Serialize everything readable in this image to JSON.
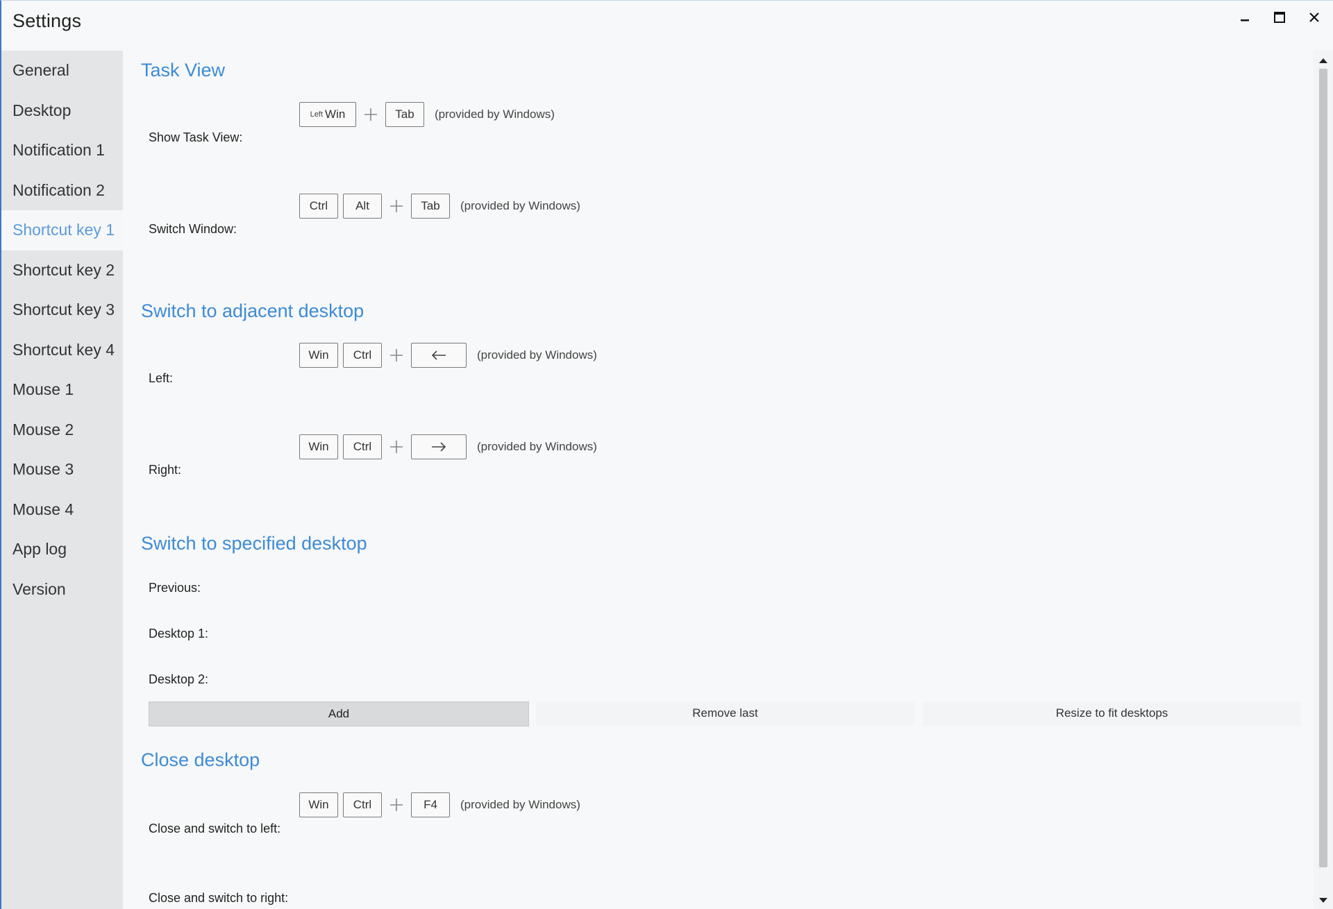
{
  "window": {
    "title": "Settings"
  },
  "sidebar": {
    "items": [
      {
        "label": "General"
      },
      {
        "label": "Desktop"
      },
      {
        "label": "Notification 1"
      },
      {
        "label": "Notification 2"
      },
      {
        "label": "Shortcut key 1",
        "active": true
      },
      {
        "label": "Shortcut key 2"
      },
      {
        "label": "Shortcut key 3"
      },
      {
        "label": "Shortcut key 4"
      },
      {
        "label": "Mouse 1"
      },
      {
        "label": "Mouse 2"
      },
      {
        "label": "Mouse 3"
      },
      {
        "label": "Mouse 4"
      },
      {
        "label": "App log"
      },
      {
        "label": "Version"
      }
    ]
  },
  "task_view": {
    "title": "Task View",
    "show_task_view": {
      "label": "Show Task View:",
      "key_small": "Left",
      "key_main": "Win",
      "key2": "Tab",
      "note": "(provided by Windows)"
    },
    "switch_window": {
      "label": "Switch Window:",
      "key1": "Ctrl",
      "key2": "Alt",
      "key3": "Tab",
      "note": "(provided by Windows)"
    }
  },
  "adjacent": {
    "title": "Switch to adjacent desktop",
    "left": {
      "label": "Left:",
      "key1": "Win",
      "key2": "Ctrl",
      "arrow_icon": "arrow-left-icon",
      "note": "(provided by Windows)"
    },
    "right": {
      "label": "Right:",
      "key1": "Win",
      "key2": "Ctrl",
      "arrow_icon": "arrow-right-icon",
      "note": "(provided by Windows)"
    }
  },
  "specified": {
    "title": "Switch to specified desktop",
    "previous_label": "Previous:",
    "desktop1_label": "Desktop 1:",
    "desktop2_label": "Desktop 2:",
    "add_label": "Add",
    "remove_label": "Remove last",
    "resize_label": "Resize to fit desktops"
  },
  "close_desktop": {
    "title": "Close desktop",
    "switch_left": {
      "label": "Close and switch to left:",
      "key1": "Win",
      "key2": "Ctrl",
      "key3": "F4",
      "note": "(provided by Windows)"
    },
    "switch_right_label": "Close and switch to right:"
  },
  "colors": {
    "accent": "#3d8bd6",
    "active_nav": "#5b9bd9",
    "sidebar_bg": "#e4e5e7"
  }
}
